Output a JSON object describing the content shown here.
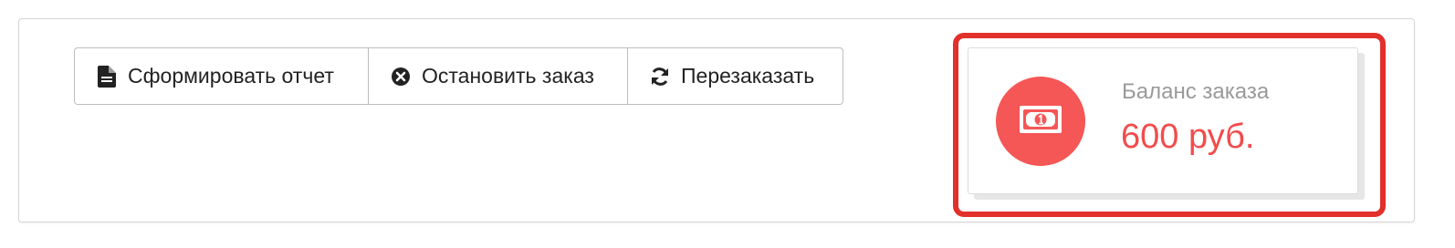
{
  "toolbar": {
    "buttons": [
      {
        "label": "Сформировать отчет",
        "icon": "file-icon"
      },
      {
        "label": "Остановить заказ",
        "icon": "times-circle-icon"
      },
      {
        "label": "Перезаказать",
        "icon": "refresh-icon"
      }
    ]
  },
  "balance_card": {
    "label": "Баланс заказа",
    "value": "600 руб.",
    "icon": "money-bill-icon"
  },
  "colors": {
    "accent": "#f55656",
    "value_text": "#f24c4c",
    "highlight_border": "#e2302a",
    "label_text": "#9a9a9a"
  }
}
